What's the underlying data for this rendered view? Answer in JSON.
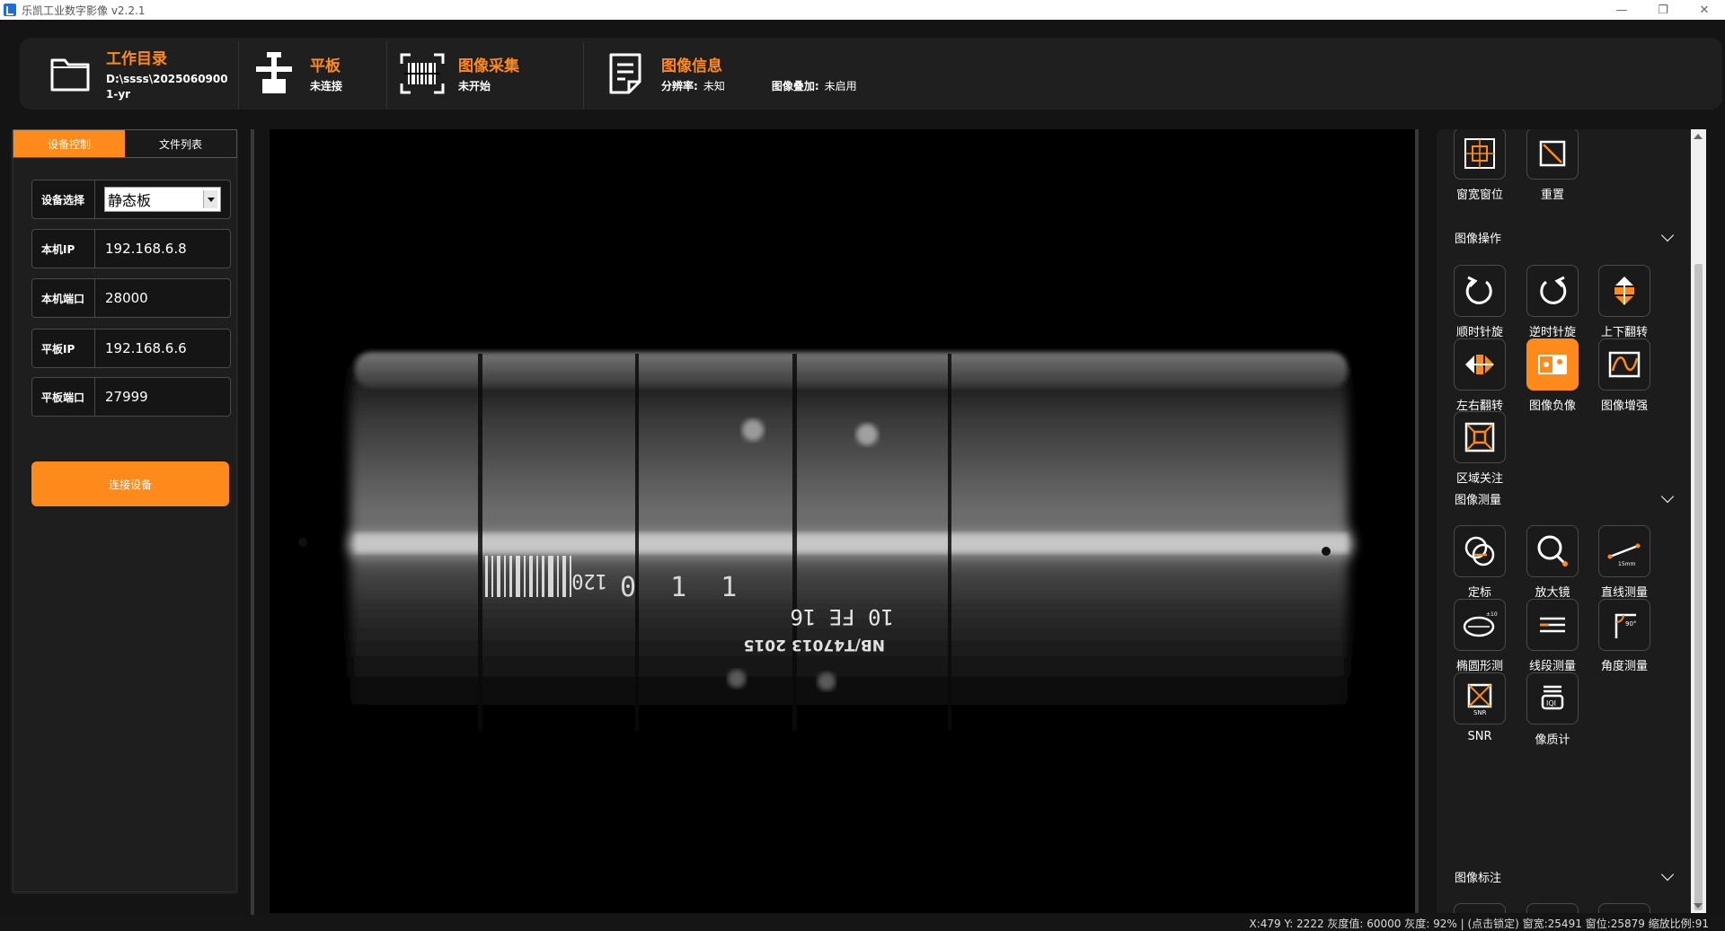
{
  "window": {
    "title": "乐凯工业数字影像 v2.2.1",
    "minimize": "—",
    "maximize": "❐",
    "close": "✕"
  },
  "header": {
    "workdir": {
      "label": "工作目录",
      "value_line1": "D:\\ssss\\2025060900",
      "value_line2": "1-yr"
    },
    "panel": {
      "label": "平板",
      "value": "未连接"
    },
    "acquire": {
      "label": "图像采集",
      "value": "未开始"
    },
    "info": {
      "label": "图像信息",
      "resolution_label": "分辨率:",
      "resolution_value": "未知",
      "overlay_label": "图像叠加:",
      "overlay_value": "未启用"
    }
  },
  "left_panel": {
    "tabs": [
      {
        "label": "设备控制",
        "active": true
      },
      {
        "label": "文件列表",
        "active": false
      }
    ],
    "fields": {
      "device": {
        "label": "设备选择",
        "value": "静态板"
      },
      "local_ip": {
        "label": "本机IP",
        "value": "192.168.6.8"
      },
      "local_port": {
        "label": "本机端口",
        "value": "28000"
      },
      "panel_ip": {
        "label": "平板IP",
        "value": "192.168.6.6"
      },
      "panel_port": {
        "label": "平板端口",
        "value": "27999"
      }
    },
    "connect_button": "连接设备"
  },
  "viewer": {
    "barcode_text": "120",
    "id_text": "0 1 1",
    "stamp_line1": "10 FE 16",
    "stamp_line2": "NB/T47013 2015"
  },
  "right_panel": {
    "top_tools": [
      {
        "label": "窗宽窗位",
        "icon": "window-level-icon"
      },
      {
        "label": "重置",
        "icon": "reset-icon"
      }
    ],
    "sections": {
      "operate": {
        "title": "图像操作",
        "tools": [
          {
            "label": "顺时针旋",
            "icon": "rotate-cw-icon"
          },
          {
            "label": "逆时针旋",
            "icon": "rotate-ccw-icon"
          },
          {
            "label": "上下翻转",
            "icon": "flip-vertical-icon"
          },
          {
            "label": "左右翻转",
            "icon": "flip-horizontal-icon"
          },
          {
            "label": "图像负像",
            "icon": "negative-icon",
            "active": true
          },
          {
            "label": "图像增强",
            "icon": "enhance-icon"
          },
          {
            "label": "区域关注",
            "icon": "roi-icon"
          }
        ]
      },
      "measure": {
        "title": "图像测量",
        "tools": [
          {
            "label": "定标",
            "icon": "calibrate-icon"
          },
          {
            "label": "放大镜",
            "icon": "magnifier-icon"
          },
          {
            "label": "直线测量",
            "icon": "line-measure-icon",
            "sub": "15mm"
          },
          {
            "label": "椭圆形测",
            "icon": "ellipse-measure-icon"
          },
          {
            "label": "线段测量",
            "icon": "segment-measure-icon"
          },
          {
            "label": "角度测量",
            "icon": "angle-measure-icon",
            "sub": "90°"
          },
          {
            "label": "SNR",
            "icon": "snr-icon",
            "sub": "SNR"
          },
          {
            "label": "像质计",
            "icon": "iqi-icon",
            "sub": "IQI"
          }
        ]
      },
      "annotate": {
        "title": "图像标注"
      }
    }
  },
  "status_bar": {
    "text": "X:479 Y: 2222 灰度值: 60000 灰度: 92%  |  (点击锁定) 窗宽:25491 窗位:25879  缩放比例:91"
  },
  "colors": {
    "accent": "#ff8a1c",
    "background": "#141414",
    "panel": "#1f1f1f"
  }
}
